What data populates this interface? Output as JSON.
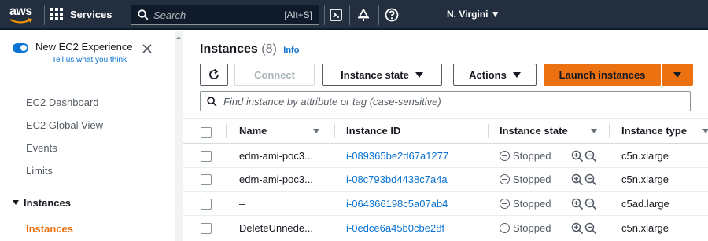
{
  "topnav": {
    "logo_text": "aws",
    "services_label": "Services",
    "search_placeholder": "Search",
    "search_shortcut": "[Alt+S]",
    "region_label": "N. Virgini ▼",
    "icons": [
      "cloudshell-icon",
      "bell-icon",
      "help-icon"
    ]
  },
  "sidebar": {
    "experience_title": "New EC2 Experience",
    "experience_link": "Tell us what you think",
    "experience_toggle_on": true,
    "items": [
      {
        "label": "EC2 Dashboard"
      },
      {
        "label": "EC2 Global View"
      },
      {
        "label": "Events"
      },
      {
        "label": "Limits"
      }
    ],
    "section_label": "Instances",
    "active_item": "Instances"
  },
  "main": {
    "title": "Instances",
    "count": "(8)",
    "info_label": "Info",
    "buttons": {
      "refresh_icon": "refresh-icon",
      "connect": "Connect",
      "instance_state": "Instance state",
      "actions": "Actions",
      "launch": "Launch instances"
    },
    "filter_placeholder": "Find instance by attribute or tag (case-sensitive)",
    "columns": [
      "Name",
      "Instance ID",
      "Instance state",
      "Instance type"
    ],
    "rows": [
      {
        "name": "edm-ami-poc3...",
        "id": "i-089365be2d67a1277",
        "state": "Stopped",
        "type": "c5n.xlarge"
      },
      {
        "name": "edm-ami-poc3...",
        "id": "i-08c793bd4438c7a4a",
        "state": "Stopped",
        "type": "c5n.xlarge"
      },
      {
        "name": "–",
        "id": "i-064366198c5a07ab4",
        "state": "Stopped",
        "type": "c5ad.large"
      },
      {
        "name": "DeleteUnnede...",
        "id": "i-0edce6a45b0cbe28f",
        "state": "Stopped",
        "type": "c5n.xlarge"
      }
    ]
  },
  "colors": {
    "nav_bg": "#232f3e",
    "link": "#0972d3",
    "accent_orange": "#ec7211"
  }
}
